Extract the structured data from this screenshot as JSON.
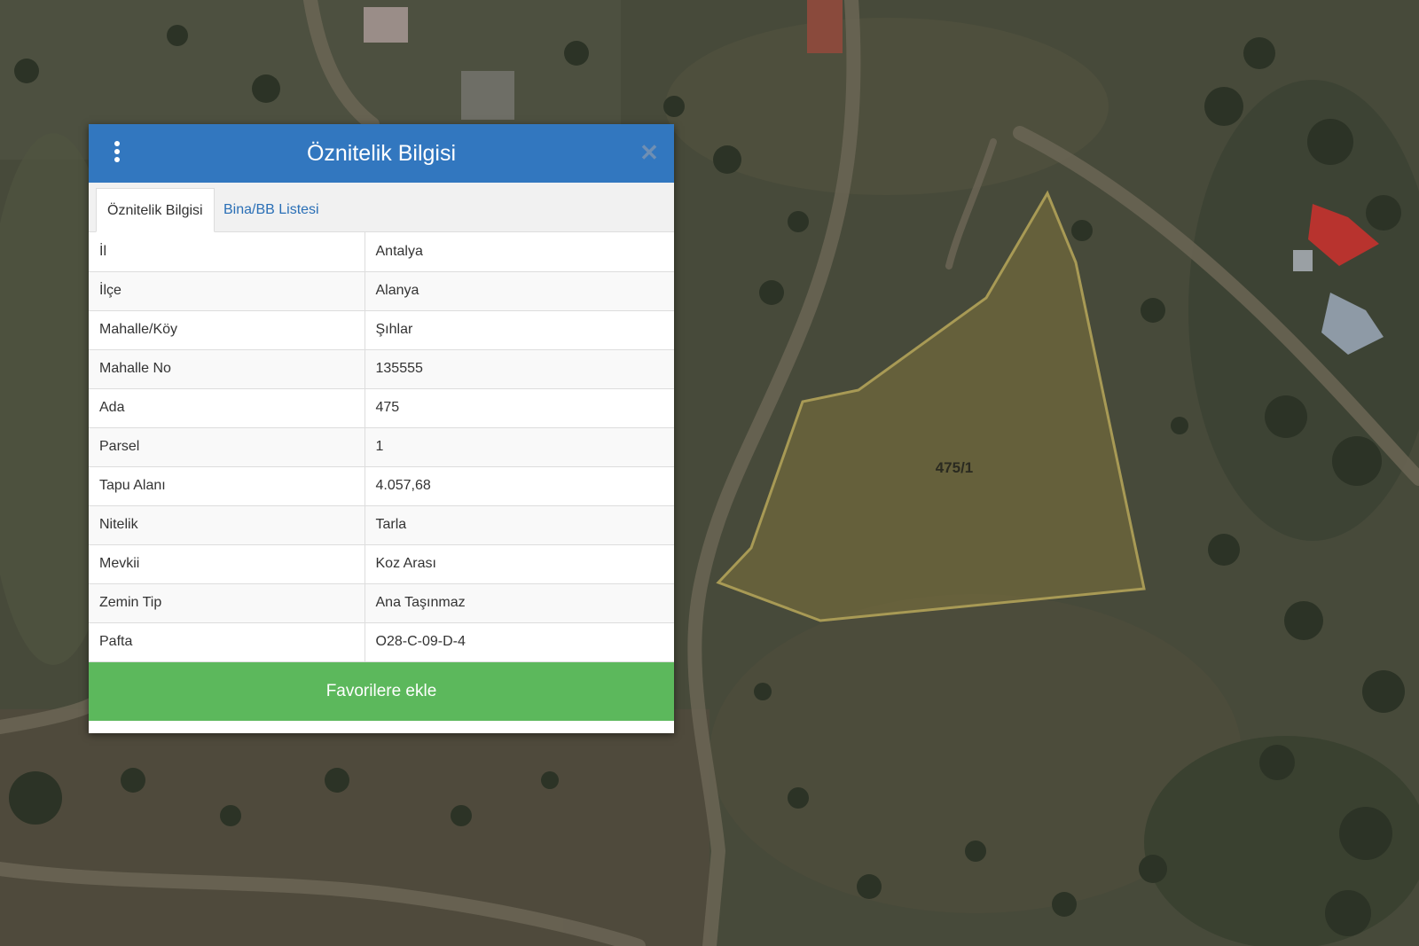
{
  "panel": {
    "title": "Öznitelik Bilgisi",
    "close_icon": "close-icon",
    "menu_icon": "kebab-menu-icon",
    "header_color": "#3277bf",
    "tabs": [
      {
        "label": "Öznitelik Bilgisi",
        "active": true
      },
      {
        "label": "Bina/BB Listesi",
        "active": false
      }
    ],
    "rows": [
      {
        "key": "İl",
        "value": "Antalya"
      },
      {
        "key": "İlçe",
        "value": "Alanya"
      },
      {
        "key": "Mahalle/Köy",
        "value": "Şıhlar"
      },
      {
        "key": "Mahalle No",
        "value": "135555"
      },
      {
        "key": "Ada",
        "value": "475"
      },
      {
        "key": "Parsel",
        "value": "1"
      },
      {
        "key": "Tapu Alanı",
        "value": "4.057,68"
      },
      {
        "key": "Nitelik",
        "value": "Tarla"
      },
      {
        "key": "Mevkii",
        "value": "Koz Arası"
      },
      {
        "key": "Zemin Tip",
        "value": "Ana Taşınmaz"
      },
      {
        "key": "Pafta",
        "value": "O28-C-09-D-4"
      }
    ],
    "favorite_button": "Favorilere ekle",
    "favorite_color": "#5cb85c"
  },
  "map": {
    "parcel_label": "475/1",
    "parcel_outline_color": "#a89a55"
  }
}
